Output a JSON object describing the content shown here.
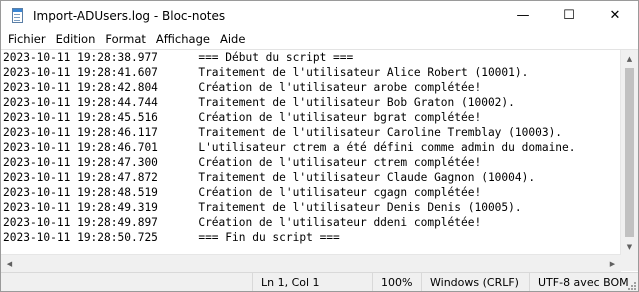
{
  "window": {
    "title": "Import-ADUsers.log - Bloc-notes",
    "minimize_glyph": "—",
    "maximize_glyph": "☐",
    "close_glyph": "✕"
  },
  "menu": {
    "items": [
      "Fichier",
      "Edition",
      "Format",
      "Affichage",
      "Aide"
    ]
  },
  "editor": {
    "lines": [
      "2023-10-11 19:28:38.977      === Début du script ===",
      "2023-10-11 19:28:41.607      Traitement de l'utilisateur Alice Robert (10001).",
      "2023-10-11 19:28:42.804      Création de l'utilisateur arobe complétée!",
      "2023-10-11 19:28:44.744      Traitement de l'utilisateur Bob Graton (10002).",
      "2023-10-11 19:28:45.516      Création de l'utilisateur bgrat complétée!",
      "2023-10-11 19:28:46.117      Traitement de l'utilisateur Caroline Tremblay (10003).",
      "2023-10-11 19:28:46.701      L'utilisateur ctrem a été défini comme admin du domaine.",
      "2023-10-11 19:28:47.300      Création de l'utilisateur ctrem complétée!",
      "2023-10-11 19:28:47.872      Traitement de l'utilisateur Claude Gagnon (10004).",
      "2023-10-11 19:28:48.519      Création de l'utilisateur cgagn complétée!",
      "2023-10-11 19:28:49.319      Traitement de l'utilisateur Denis Denis (10005).",
      "2023-10-11 19:28:49.897      Création de l'utilisateur ddeni complétée!",
      "2023-10-11 19:28:50.725      === Fin du script ==="
    ]
  },
  "status": {
    "position": "Ln 1, Col 1",
    "zoom": "100%",
    "line_ending": "Windows (CRLF)",
    "encoding": "UTF-8 avec BOM"
  }
}
